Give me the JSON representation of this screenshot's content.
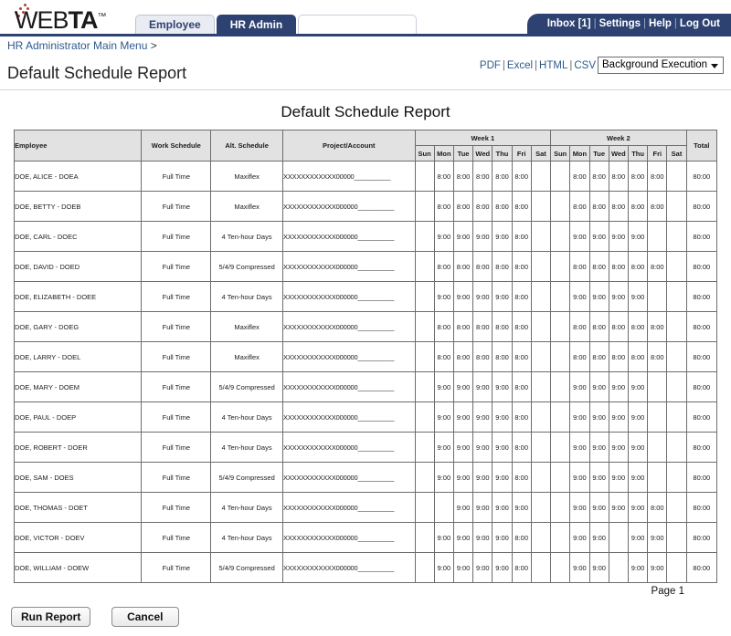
{
  "header": {
    "logo_light": "WEB",
    "logo_bold": "TA",
    "logo_tm": "™",
    "tabs": [
      {
        "label": "Employee",
        "active": false
      },
      {
        "label": "HR Admin",
        "active": true
      }
    ],
    "user_links": [
      "Inbox [1]",
      "Settings",
      "Help",
      "Log Out"
    ],
    "separator": "|"
  },
  "breadcrumb": {
    "text": "HR Administrator Main Menu",
    "arrow": ">"
  },
  "page": {
    "title": "Default Schedule Report",
    "export_links": [
      "PDF",
      "Excel",
      "HTML",
      "CSV"
    ],
    "export_separator": "|",
    "background_execution_label": "Background Execution"
  },
  "report": {
    "title": "Default Schedule Report",
    "page_label": "Page 1",
    "columns": {
      "employee": "Employee",
      "work_schedule": "Work Schedule",
      "alt_schedule": "Alt. Schedule",
      "project_account": "Project/Account",
      "week1": "Week 1",
      "week2": "Week 2",
      "total": "Total"
    },
    "days": [
      "Sun",
      "Mon",
      "Tue",
      "Wed",
      "Thu",
      "Fri",
      "Sat"
    ],
    "rows": [
      {
        "employee": "DOE, ALICE - DOEA",
        "work_schedule": "Full Time",
        "alt_schedule": "Maxiflex",
        "project_account": "XXXXXXXXXXXX00000__________",
        "week1": [
          "",
          "8:00",
          "8:00",
          "8:00",
          "8:00",
          "8:00",
          ""
        ],
        "week2": [
          "",
          "8:00",
          "8:00",
          "8:00",
          "8:00",
          "8:00",
          ""
        ],
        "total": "80:00"
      },
      {
        "employee": "DOE, BETTY - DOEB",
        "work_schedule": "Full Time",
        "alt_schedule": "Maxiflex",
        "project_account": "XXXXXXXXXXXX000000__________",
        "week1": [
          "",
          "8:00",
          "8:00",
          "8:00",
          "8:00",
          "8:00",
          ""
        ],
        "week2": [
          "",
          "8:00",
          "8:00",
          "8:00",
          "8:00",
          "8:00",
          ""
        ],
        "total": "80:00"
      },
      {
        "employee": "DOE, CARL - DOEC",
        "work_schedule": "Full Time",
        "alt_schedule": "4 Ten-hour Days",
        "project_account": "XXXXXXXXXXXX000000__________",
        "week1": [
          "",
          "9:00",
          "9:00",
          "9:00",
          "9:00",
          "8:00",
          ""
        ],
        "week2": [
          "",
          "9:00",
          "9:00",
          "9:00",
          "9:00",
          "",
          ""
        ],
        "total": "80:00"
      },
      {
        "employee": "DOE, DAVID - DOED",
        "work_schedule": "Full Time",
        "alt_schedule": "5/4/9 Compressed",
        "project_account": "XXXXXXXXXXXX000000__________",
        "week1": [
          "",
          "8:00",
          "8:00",
          "8:00",
          "8:00",
          "8:00",
          ""
        ],
        "week2": [
          "",
          "8:00",
          "8:00",
          "8:00",
          "8:00",
          "8:00",
          ""
        ],
        "total": "80:00"
      },
      {
        "employee": "DOE, ELIZABETH - DOEE",
        "work_schedule": "Full Time",
        "alt_schedule": "4 Ten-hour Days",
        "project_account": "XXXXXXXXXXXX000000__________",
        "week1": [
          "",
          "9:00",
          "9:00",
          "9:00",
          "9:00",
          "8:00",
          ""
        ],
        "week2": [
          "",
          "9:00",
          "9:00",
          "9:00",
          "9:00",
          "",
          ""
        ],
        "total": "80:00"
      },
      {
        "employee": "DOE, GARY - DOEG",
        "work_schedule": "Full Time",
        "alt_schedule": "Maxiflex",
        "project_account": "XXXXXXXXXXXX000000__________",
        "week1": [
          "",
          "8:00",
          "8:00",
          "8:00",
          "8:00",
          "8:00",
          ""
        ],
        "week2": [
          "",
          "8:00",
          "8:00",
          "8:00",
          "8:00",
          "8:00",
          ""
        ],
        "total": "80:00"
      },
      {
        "employee": "DOE, LARRY - DOEL",
        "work_schedule": "Full Time",
        "alt_schedule": "Maxiflex",
        "project_account": "XXXXXXXXXXXX000000__________",
        "week1": [
          "",
          "8:00",
          "8:00",
          "8:00",
          "8:00",
          "8:00",
          ""
        ],
        "week2": [
          "",
          "8:00",
          "8:00",
          "8:00",
          "8:00",
          "8:00",
          ""
        ],
        "total": "80:00"
      },
      {
        "employee": "DOE, MARY - DOEM",
        "work_schedule": "Full Time",
        "alt_schedule": "5/4/9 Compressed",
        "project_account": "XXXXXXXXXXXX000000__________",
        "week1": [
          "",
          "9:00",
          "9:00",
          "9:00",
          "9:00",
          "8:00",
          ""
        ],
        "week2": [
          "",
          "9:00",
          "9:00",
          "9:00",
          "9:00",
          "",
          ""
        ],
        "total": "80:00"
      },
      {
        "employee": "DOE, PAUL - DOEP",
        "work_schedule": "Full Time",
        "alt_schedule": "4 Ten-hour Days",
        "project_account": "XXXXXXXXXXXX000000__________",
        "week1": [
          "",
          "9:00",
          "9:00",
          "9:00",
          "9:00",
          "8:00",
          ""
        ],
        "week2": [
          "",
          "9:00",
          "9:00",
          "9:00",
          "9:00",
          "",
          ""
        ],
        "total": "80:00"
      },
      {
        "employee": "DOE, ROBERT - DOER",
        "work_schedule": "Full Time",
        "alt_schedule": "4 Ten-hour Days",
        "project_account": "XXXXXXXXXXXX000000__________",
        "week1": [
          "",
          "9:00",
          "9:00",
          "9:00",
          "9:00",
          "8:00",
          ""
        ],
        "week2": [
          "",
          "9:00",
          "9:00",
          "9:00",
          "9:00",
          "",
          ""
        ],
        "total": "80:00"
      },
      {
        "employee": "DOE, SAM - DOES",
        "work_schedule": "Full Time",
        "alt_schedule": "5/4/9 Compressed",
        "project_account": "XXXXXXXXXXXX000000__________",
        "week1": [
          "",
          "9:00",
          "9:00",
          "9:00",
          "9:00",
          "8:00",
          ""
        ],
        "week2": [
          "",
          "9:00",
          "9:00",
          "9:00",
          "9:00",
          "",
          ""
        ],
        "total": "80:00"
      },
      {
        "employee": "DOE, THOMAS - DOET",
        "work_schedule": "Full Time",
        "alt_schedule": "4 Ten-hour Days",
        "project_account": "XXXXXXXXXXXX000000__________",
        "week1": [
          "",
          "",
          "9:00",
          "9:00",
          "9:00",
          "9:00",
          ""
        ],
        "week2": [
          "",
          "9:00",
          "9:00",
          "9:00",
          "9:00",
          "8:00",
          ""
        ],
        "total": "80:00"
      },
      {
        "employee": "DOE, VICTOR - DOEV",
        "work_schedule": "Full Time",
        "alt_schedule": "4 Ten-hour Days",
        "project_account": "XXXXXXXXXXXX000000__________",
        "week1": [
          "",
          "9:00",
          "9:00",
          "9:00",
          "9:00",
          "8:00",
          ""
        ],
        "week2": [
          "",
          "9:00",
          "9:00",
          "",
          "9:00",
          "9:00",
          ""
        ],
        "total": "80:00"
      },
      {
        "employee": "DOE, WILLIAM - DOEW",
        "work_schedule": "Full Time",
        "alt_schedule": "5/4/9 Compressed",
        "project_account": "XXXXXXXXXXXX000000__________",
        "week1": [
          "",
          "9:00",
          "9:00",
          "9:00",
          "9:00",
          "8:00",
          ""
        ],
        "week2": [
          "",
          "9:00",
          "9:00",
          "",
          "9:00",
          "9:00",
          ""
        ],
        "total": "80:00"
      }
    ]
  },
  "footer": {
    "run_report_label": "Run Report",
    "cancel_label": "Cancel"
  },
  "colors": {
    "brand_navy": "#2e4272",
    "link_blue": "#2e5a8e",
    "header_grey": "#e2e2e2",
    "logo_dot_red": "#b0402c"
  }
}
